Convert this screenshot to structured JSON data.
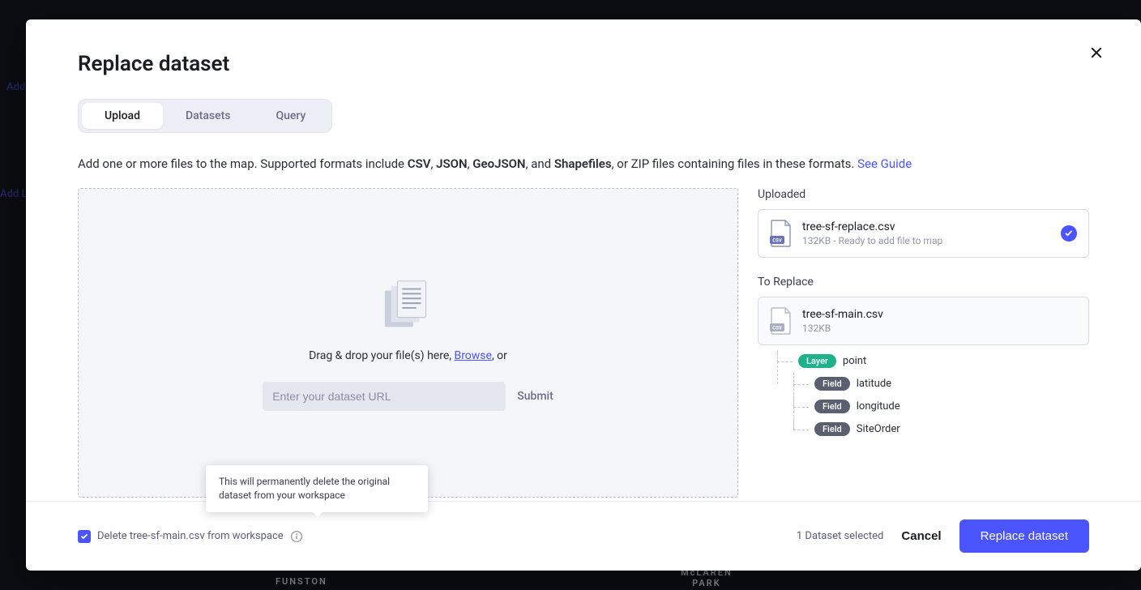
{
  "background": {
    "sidebar_add": "Add",
    "sidebar_add_layer": "Add L",
    "park1": "FUNSTON",
    "park2": "McLAREN\nPARK"
  },
  "modal": {
    "title": "Replace dataset",
    "tabs": {
      "upload": "Upload",
      "datasets": "Datasets",
      "query": "Query"
    },
    "helper": {
      "prefix": "Add one or more files to the map. Supported formats include ",
      "fmt1": "CSV",
      "sep1": ", ",
      "fmt2": "JSON",
      "sep2": ", ",
      "fmt3": "GeoJSON",
      "sep3": ", and ",
      "fmt4": "Shapefiles",
      "suffix": ", or ZIP files containing files in these formats. ",
      "link": "See Guide"
    },
    "dropzone": {
      "text_prefix": "Drag & drop your file(s) here, ",
      "browse": "Browse",
      "text_suffix": ", or",
      "placeholder": "Enter your dataset URL",
      "submit": "Submit"
    },
    "uploaded": {
      "label": "Uploaded",
      "file_name": "tree-sf-replace.csv",
      "file_meta": "132KB - Ready to add file to map"
    },
    "to_replace": {
      "label": "To Replace",
      "file_name": "tree-sf-main.csv",
      "file_meta": "132KB",
      "layer_tag": "Layer",
      "layer_name": "point",
      "field_tag": "Field",
      "fields": [
        "latitude",
        "longitude",
        "SiteOrder"
      ]
    },
    "tooltip": "This will permanently delete the original dataset from your workspace",
    "footer": {
      "delete_label": "Delete tree-sf-main.csv from workspace",
      "selected": "1 Dataset selected",
      "cancel": "Cancel",
      "replace": "Replace dataset"
    }
  }
}
